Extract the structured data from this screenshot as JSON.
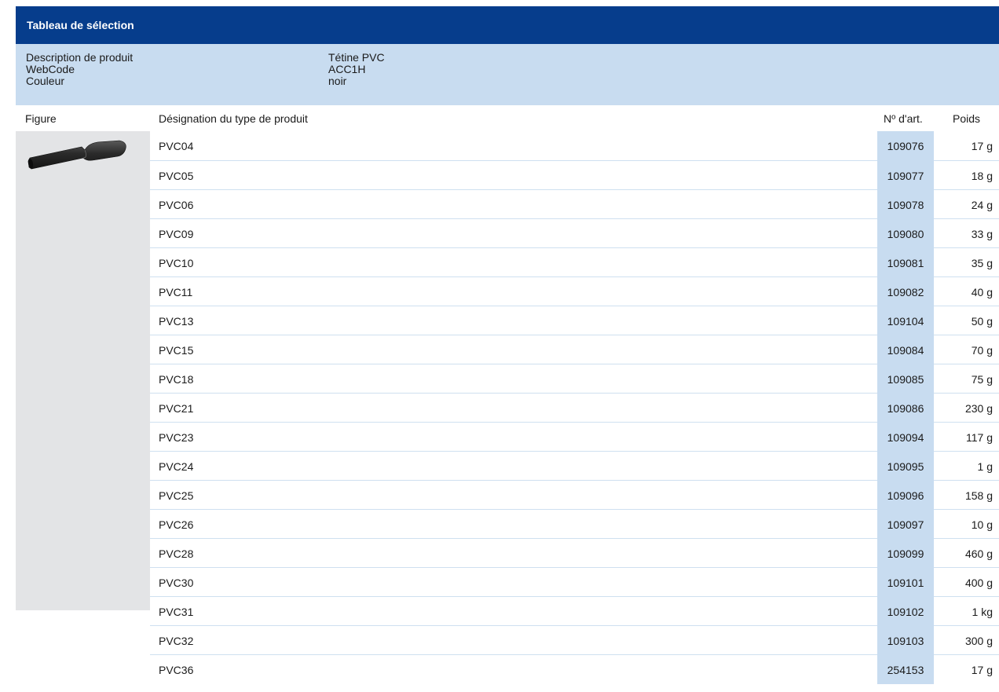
{
  "header": {
    "title": "Tableau de sélection"
  },
  "info": {
    "labels": [
      "Description de produit",
      "WebCode",
      "Couleur"
    ],
    "values": [
      "Tétine PVC",
      "ACC1H",
      "noir"
    ]
  },
  "columns": {
    "figure": "Figure",
    "designation": "Désignation du type de produit",
    "article": "Nº d'art.",
    "weight": "Poids"
  },
  "figure": {
    "icon": "pvc-sleeve-image",
    "color": "#2b2b2b"
  },
  "rows": [
    {
      "name": "PVC04",
      "article": "109076",
      "weight": "17 g"
    },
    {
      "name": "PVC05",
      "article": "109077",
      "weight": "18 g"
    },
    {
      "name": "PVC06",
      "article": "109078",
      "weight": "24 g"
    },
    {
      "name": "PVC09",
      "article": "109080",
      "weight": "33 g"
    },
    {
      "name": "PVC10",
      "article": "109081",
      "weight": "35 g"
    },
    {
      "name": "PVC11",
      "article": "109082",
      "weight": "40 g"
    },
    {
      "name": "PVC13",
      "article": "109104",
      "weight": "50 g"
    },
    {
      "name": "PVC15",
      "article": "109084",
      "weight": "70 g"
    },
    {
      "name": "PVC18",
      "article": "109085",
      "weight": "75 g"
    },
    {
      "name": "PVC21",
      "article": "109086",
      "weight": "230 g"
    },
    {
      "name": "PVC23",
      "article": "109094",
      "weight": "117 g"
    },
    {
      "name": "PVC24",
      "article": "109095",
      "weight": "1 g"
    },
    {
      "name": "PVC25",
      "article": "109096",
      "weight": "158 g"
    },
    {
      "name": "PVC26",
      "article": "109097",
      "weight": "10 g"
    },
    {
      "name": "PVC28",
      "article": "109099",
      "weight": "460 g"
    },
    {
      "name": "PVC30",
      "article": "109101",
      "weight": "400 g"
    },
    {
      "name": "PVC31",
      "article": "109102",
      "weight": "1 kg"
    },
    {
      "name": "PVC32",
      "article": "109103",
      "weight": "300 g"
    },
    {
      "name": "PVC36",
      "article": "254153",
      "weight": "17 g"
    }
  ]
}
